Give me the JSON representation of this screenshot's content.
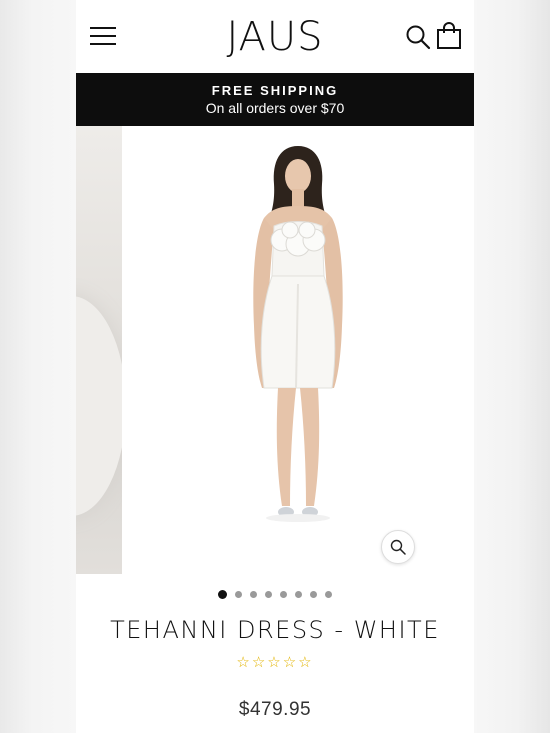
{
  "header": {
    "logo": "JAUS",
    "icons": {
      "menu": "hamburger-menu-icon",
      "search": "search-icon",
      "cart": "shopping-bag-icon"
    }
  },
  "promo": {
    "title": "FREE SHIPPING",
    "subtitle": "On all orders over $70"
  },
  "gallery": {
    "slide_count": 8,
    "active_index": 0,
    "zoom_icon": "zoom-icon"
  },
  "product": {
    "name": "TEHANNI DRESS - WHITE",
    "rating": {
      "stars_display": "☆☆☆☆☆",
      "filled": 0,
      "max": 5,
      "color": "#e2b400"
    },
    "price": "$479.95"
  },
  "colors": {
    "promo_bg": "#0d0d0d",
    "text": "#111111"
  }
}
